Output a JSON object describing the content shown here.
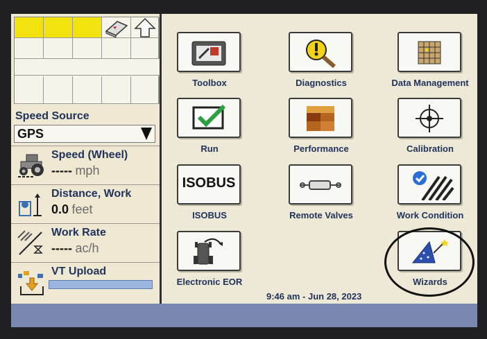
{
  "left": {
    "speed_source_label": "Speed Source",
    "speed_source_value": "GPS",
    "speed_label": "Speed (Wheel)",
    "speed_value": "-----",
    "speed_unit": "mph",
    "distance_label": "Distance, Work",
    "distance_value": "0.0",
    "distance_unit": "feet",
    "workrate_label": "Work Rate",
    "workrate_value": "-----",
    "workrate_unit": "ac/h",
    "vt_label": "VT Upload"
  },
  "apps": [
    {
      "label": "Toolbox"
    },
    {
      "label": "Diagnostics"
    },
    {
      "label": "Data Management"
    },
    {
      "label": "Run"
    },
    {
      "label": "Performance"
    },
    {
      "label": "Calibration"
    },
    {
      "label": "ISOBUS",
      "icon_text": "ISOBUS"
    },
    {
      "label": "Remote Valves"
    },
    {
      "label": "Work Condition"
    },
    {
      "label": "Electronic EOR"
    },
    {
      "label": "Wizards"
    }
  ],
  "status": {
    "time": "9:46 am - Jun 28, 2023"
  },
  "colors": {
    "label_blue": "#20335a",
    "indicator_yellow": "#f2e20e",
    "bottom_bar": "#7686ad"
  }
}
